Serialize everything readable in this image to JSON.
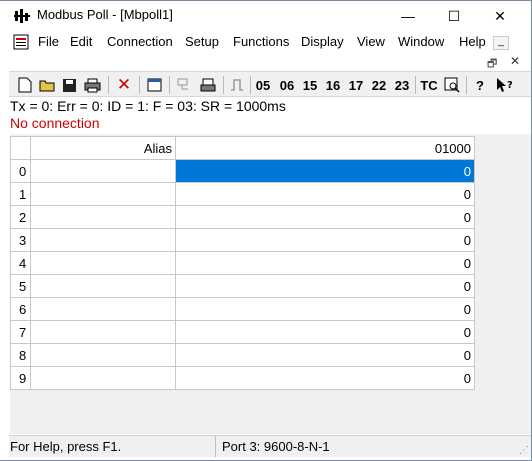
{
  "window": {
    "title": "Modbus Poll - [Mbpoll1]",
    "minimize": "—",
    "maximize": "☐",
    "close": "✕"
  },
  "menu": {
    "items": [
      "File",
      "Edit",
      "Connection",
      "Setup",
      "Functions",
      "Display",
      "View",
      "Window",
      "Help"
    ],
    "mdi_minimize": "_",
    "mdi_restore": "🗗",
    "mdi_close": "✕"
  },
  "toolbar": {
    "function_codes": [
      "05",
      "06",
      "15",
      "16",
      "17",
      "22",
      "23"
    ],
    "tc_label": "TC",
    "help_label": "?"
  },
  "status": {
    "summary": "Tx = 0: Err = 0: ID = 1: F = 03: SR = 1000ms",
    "connection": "No connection"
  },
  "grid": {
    "alias_header": "Alias",
    "address_header": "01000",
    "rows": [
      {
        "index": "0",
        "alias": "",
        "value": "0"
      },
      {
        "index": "1",
        "alias": "",
        "value": "0"
      },
      {
        "index": "2",
        "alias": "",
        "value": "0"
      },
      {
        "index": "3",
        "alias": "",
        "value": "0"
      },
      {
        "index": "4",
        "alias": "",
        "value": "0"
      },
      {
        "index": "5",
        "alias": "",
        "value": "0"
      },
      {
        "index": "6",
        "alias": "",
        "value": "0"
      },
      {
        "index": "7",
        "alias": "",
        "value": "0"
      },
      {
        "index": "8",
        "alias": "",
        "value": "0"
      },
      {
        "index": "9",
        "alias": "",
        "value": "0"
      }
    ],
    "selected_row": 0
  },
  "statusbar": {
    "help": "For Help, press F1.",
    "port": "Port 3: 9600-8-N-1"
  },
  "colors": {
    "selection": "#0078d7",
    "error_text": "#cc0000"
  }
}
